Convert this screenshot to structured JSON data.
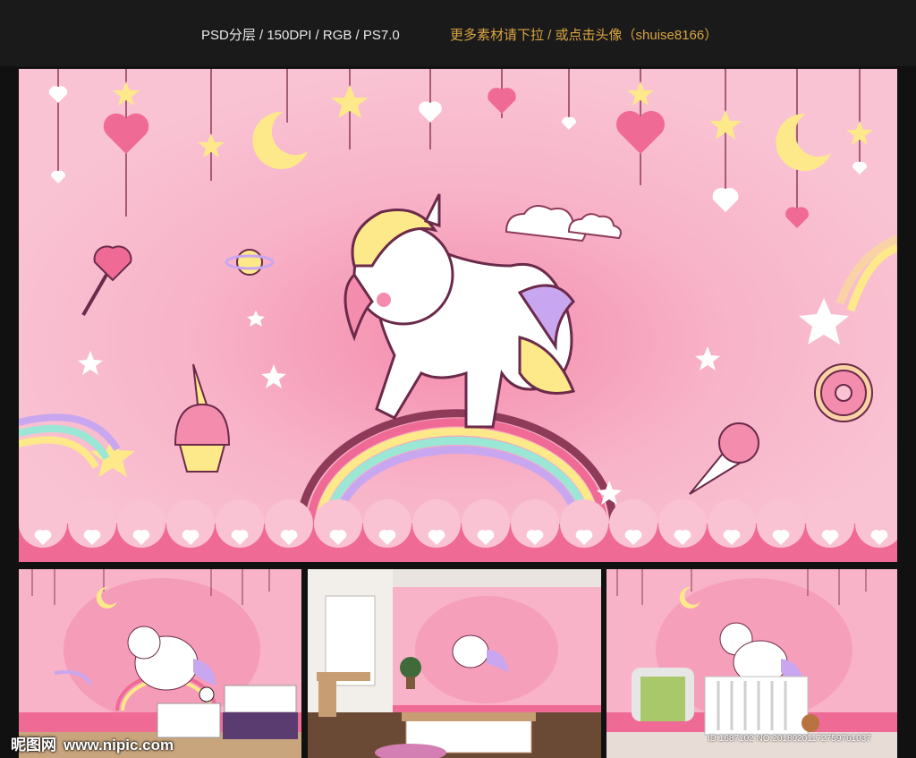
{
  "header": {
    "file_info": "PSD分层 / 150DPI / RGB / PS7.0",
    "more_text": "更多素材请下拉 / 或点击头像（shuise8166）"
  },
  "watermark": {
    "site_name": "昵图网",
    "site_url": "www.nipic.com",
    "image_id": "ID:1687102 NO:20180201172759761037"
  },
  "colors": {
    "background": "#111111",
    "pink": "#F7B6C8",
    "hot_pink": "#F06A96",
    "yellow": "#FDE98A",
    "purple": "#C8A7F0",
    "mint": "#9AE7D6"
  },
  "images": {
    "hero": "unicorn-on-rainbow-mural",
    "thumb_1": "mural-kids-room-with-white-bed",
    "thumb_2": "mural-bedroom-with-window-and-desk",
    "thumb_3": "mural-nursery-with-armchair-and-crib"
  }
}
